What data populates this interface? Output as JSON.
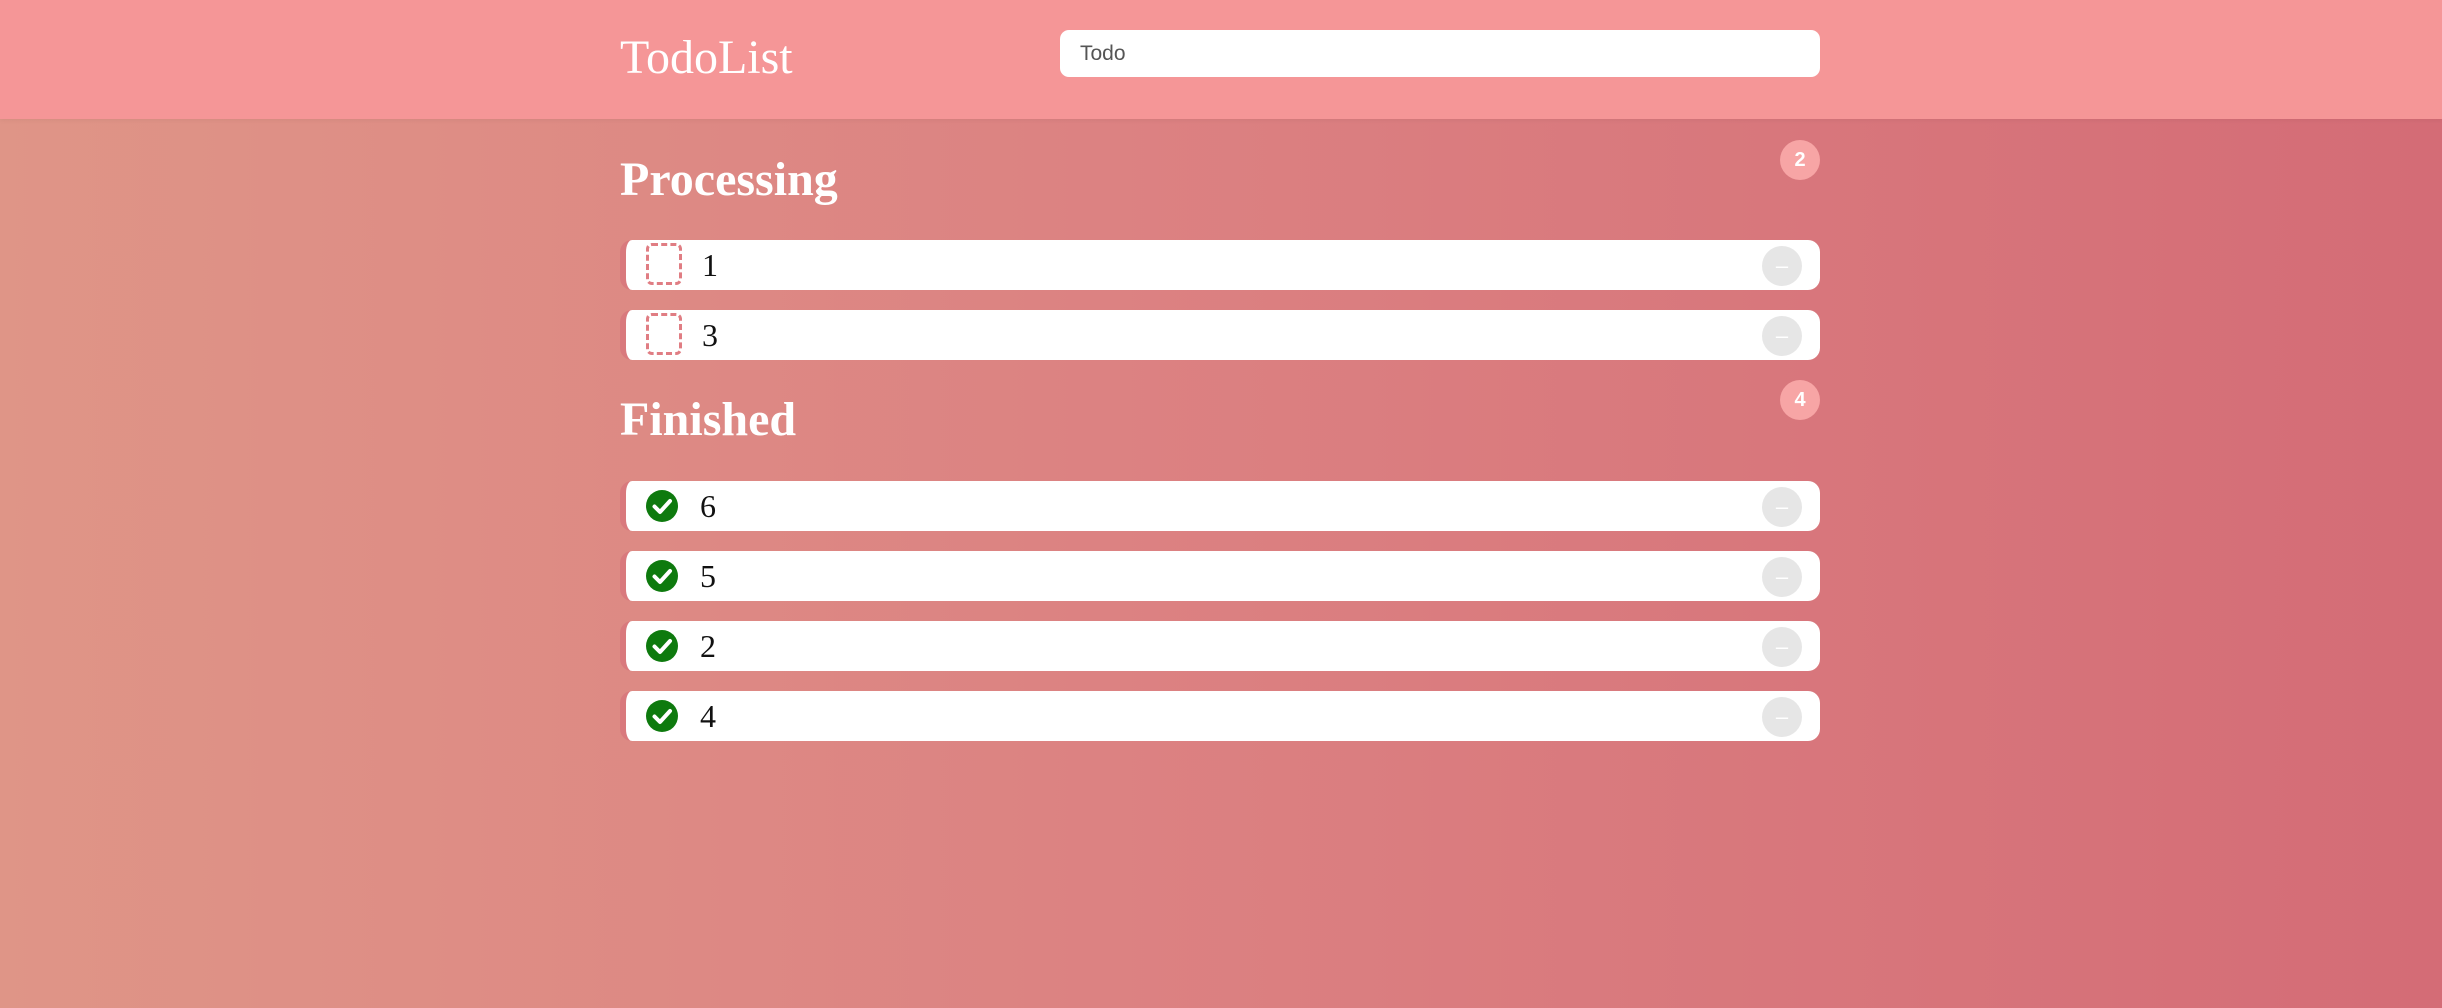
{
  "app": {
    "title": "TodoList"
  },
  "search": {
    "placeholder": "Todo",
    "value": ""
  },
  "colors": {
    "header": "#f59697",
    "background_start": "#df9587",
    "background_end": "#d46c76",
    "done_check": "#0e7a0e",
    "pending_checkbox_border": "#e07d83"
  },
  "sections": {
    "processing": {
      "title": "Processing",
      "count": "2",
      "items": [
        {
          "text": "1",
          "status": "pending",
          "delete_label": "–"
        },
        {
          "text": "3",
          "status": "pending",
          "delete_label": "–"
        }
      ]
    },
    "finished": {
      "title": "Finished",
      "count": "4",
      "items": [
        {
          "text": "6",
          "status": "done",
          "icon": "check-circle-icon",
          "delete_label": "–"
        },
        {
          "text": "5",
          "status": "done",
          "icon": "check-circle-icon",
          "delete_label": "–"
        },
        {
          "text": "2",
          "status": "done",
          "icon": "check-circle-icon",
          "delete_label": "–"
        },
        {
          "text": "4",
          "status": "done",
          "icon": "check-circle-icon",
          "delete_label": "–"
        }
      ]
    }
  }
}
